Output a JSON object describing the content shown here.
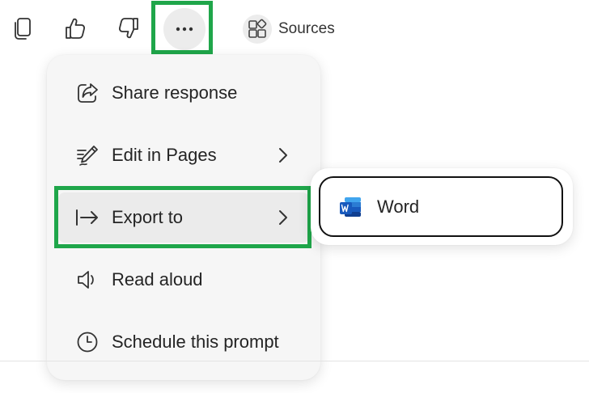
{
  "toolbar": {
    "copy_icon": "copy-icon",
    "like_icon": "thumbs-up-icon",
    "dislike_icon": "thumbs-down-icon",
    "more_icon": "more-horizontal-icon",
    "more_glyph": "···",
    "sources_icon": "apps-grid-icon",
    "sources_label": "Sources"
  },
  "menu": {
    "items": [
      {
        "label": "Share response",
        "icon": "share-icon",
        "has_submenu": false
      },
      {
        "label": "Edit in Pages",
        "icon": "edit-pen-icon",
        "has_submenu": true
      },
      {
        "label": "Export to",
        "icon": "export-arrow-icon",
        "has_submenu": true,
        "active": true
      },
      {
        "label": "Read aloud",
        "icon": "speaker-icon",
        "has_submenu": false
      },
      {
        "label": "Schedule this prompt",
        "icon": "clock-icon",
        "has_submenu": false
      }
    ]
  },
  "submenu": {
    "items": [
      {
        "label": "Word",
        "icon": "word-app-icon"
      }
    ]
  },
  "colors": {
    "highlight": "#1fa64a",
    "menu_bg": "#f6f6f6",
    "active_item_bg": "#ebebeb",
    "word_blue": "#185abd"
  }
}
